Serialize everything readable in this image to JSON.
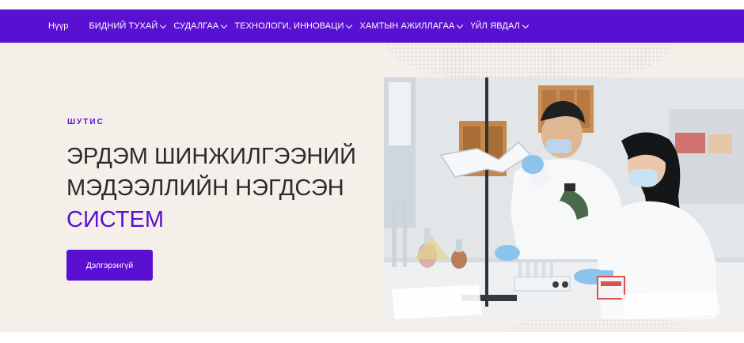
{
  "nav": {
    "items": [
      {
        "label": "Нүүр",
        "has_dropdown": false
      },
      {
        "label": "БИДНИЙ ТУХАЙ",
        "has_dropdown": true
      },
      {
        "label": "СУДАЛГАА",
        "has_dropdown": true
      },
      {
        "label": "ТЕХНОЛОГИ, ИННОВАЦИ",
        "has_dropdown": true
      },
      {
        "label": "ХАМТЫН АЖИЛЛАГАА",
        "has_dropdown": true
      },
      {
        "label": "ҮЙЛ ЯВДАЛ",
        "has_dropdown": true
      }
    ],
    "icon": "chevron-down-icon"
  },
  "hero": {
    "eyebrow": "ШУТИС",
    "title_line1": "ЭРДЭМ ШИНЖИЛГЭЭНИЙ",
    "title_line2": "МЭДЭЭЛЛИЙН НЭГДСЭН",
    "title_line3": "СИСТЕМ",
    "cta_label": "Дэлгэрэнгүй"
  },
  "colors": {
    "brand": "#5a10d0",
    "hero_background": "#f4efe9",
    "title_text": "#2b2b2b"
  }
}
